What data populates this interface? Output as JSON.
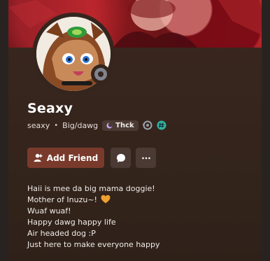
{
  "profile": {
    "display_name": "Seaxy",
    "username": "seaxy",
    "separator": "•",
    "pronouns": "Big/dawg",
    "tag": "Thck",
    "status": "idle"
  },
  "actions": {
    "add_friend_label": "Add Friend"
  },
  "bio": {
    "lines": [
      "Haii is mee da big mama doggie!",
      "Mother of Inuzu~!",
      "Wuaf wuaf!",
      "Happy dawg happy life",
      "Air headed dog :P",
      "Just here to make everyone happy"
    ],
    "heart_color": "#f0a030"
  },
  "colors": {
    "card_bg": "#3a2820",
    "accent_button": "#7a3a2b",
    "secondary_button": "#4a3a33",
    "badge_teal": "#2fb3a0"
  }
}
